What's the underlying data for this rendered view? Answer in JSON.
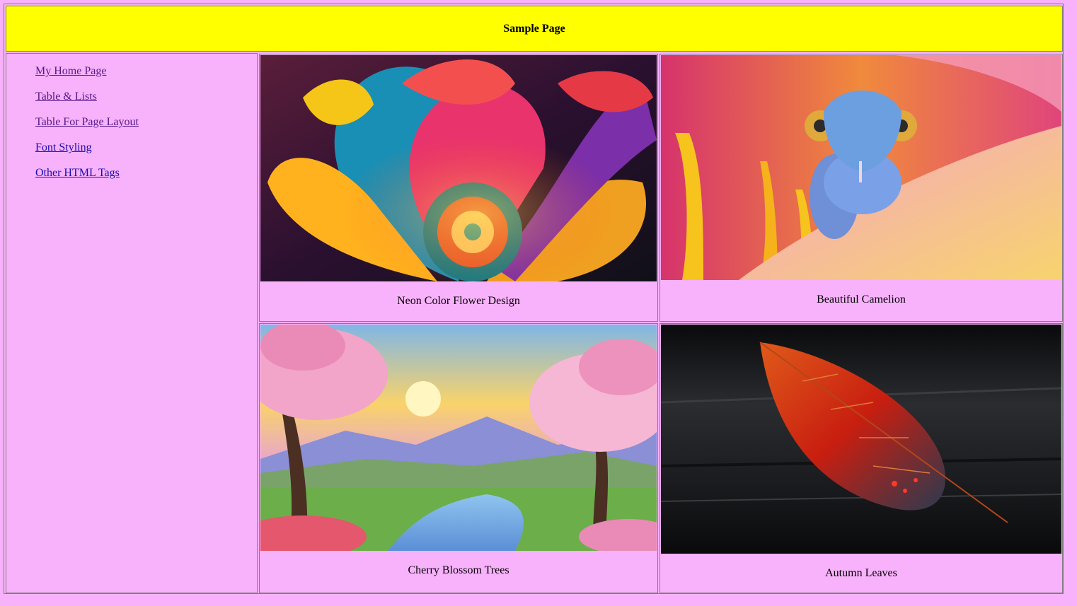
{
  "header": {
    "title": "Sample Page"
  },
  "sidebar": {
    "links": [
      {
        "label": "My Home Page",
        "visited": true
      },
      {
        "label": "Table & Lists",
        "visited": true
      },
      {
        "label": "Table For Page Layout",
        "visited": true
      },
      {
        "label": "Font Styling",
        "visited": false
      },
      {
        "label": "Other HTML Tags",
        "visited": false
      }
    ]
  },
  "gallery": {
    "items": [
      {
        "caption": "Neon Color Flower Design"
      },
      {
        "caption": "Beautiful Camelion"
      },
      {
        "caption": "Cherry Blossom Trees"
      },
      {
        "caption": "Autumn Leaves"
      }
    ]
  },
  "colors": {
    "page_background": "#f8b2fb",
    "header_background": "#ffff00",
    "link": "#1a0dab",
    "link_visited": "#551a8b",
    "border": "#7f7f7f"
  }
}
